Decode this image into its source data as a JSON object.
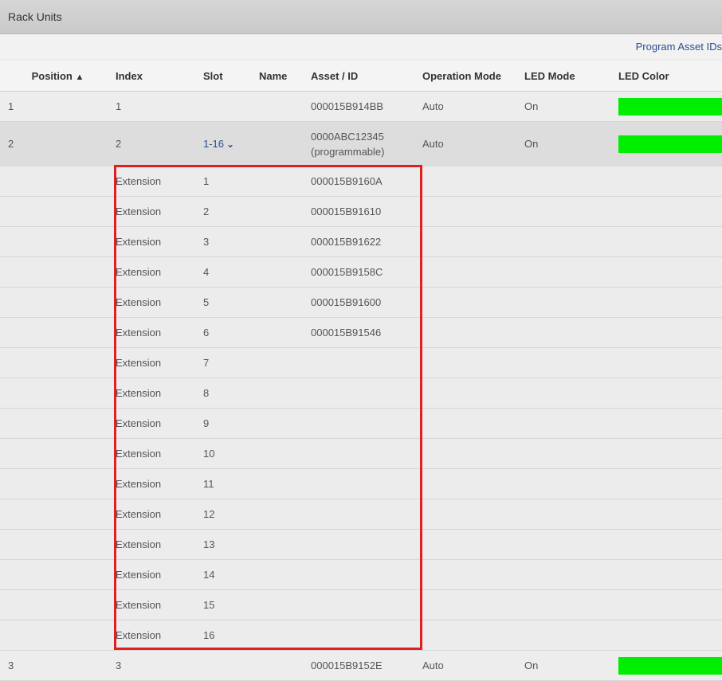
{
  "panel": {
    "title": "Rack Units",
    "program_link": "Program Asset IDs"
  },
  "columns": [
    "Position",
    "Index",
    "Slot",
    "Name",
    "Asset / ID",
    "Operation Mode",
    "LED Mode",
    "LED Color"
  ],
  "sort_indicator": "▲",
  "rows": [
    {
      "position": "1",
      "index": "1",
      "slot": "",
      "name": "",
      "asset": "000015B914BB",
      "asset_note": "",
      "mode": "Auto",
      "led_mode": "On",
      "led_color": "#00ee00"
    },
    {
      "position": "2",
      "index": "2",
      "slot": "1-16",
      "name": "",
      "asset": "0000ABC12345",
      "asset_note": "(programmable)",
      "mode": "Auto",
      "led_mode": "On",
      "led_color": "#00ee00"
    },
    {
      "position": "3",
      "index": "3",
      "slot": "",
      "name": "",
      "asset": "000015B9152E",
      "asset_note": "",
      "mode": "Auto",
      "led_mode": "On",
      "led_color": "#00ee00"
    }
  ],
  "extensions": [
    {
      "label": "Extension",
      "slot": "1",
      "asset": "000015B9160A"
    },
    {
      "label": "Extension",
      "slot": "2",
      "asset": "000015B91610"
    },
    {
      "label": "Extension",
      "slot": "3",
      "asset": "000015B91622"
    },
    {
      "label": "Extension",
      "slot": "4",
      "asset": "000015B9158C"
    },
    {
      "label": "Extension",
      "slot": "5",
      "asset": "000015B91600"
    },
    {
      "label": "Extension",
      "slot": "6",
      "asset": "000015B91546"
    },
    {
      "label": "Extension",
      "slot": "7",
      "asset": ""
    },
    {
      "label": "Extension",
      "slot": "8",
      "asset": ""
    },
    {
      "label": "Extension",
      "slot": "9",
      "asset": ""
    },
    {
      "label": "Extension",
      "slot": "10",
      "asset": ""
    },
    {
      "label": "Extension",
      "slot": "11",
      "asset": ""
    },
    {
      "label": "Extension",
      "slot": "12",
      "asset": ""
    },
    {
      "label": "Extension",
      "slot": "13",
      "asset": ""
    },
    {
      "label": "Extension",
      "slot": "14",
      "asset": ""
    },
    {
      "label": "Extension",
      "slot": "15",
      "asset": ""
    },
    {
      "label": "Extension",
      "slot": "16",
      "asset": ""
    }
  ],
  "colors": {
    "highlight_border": "#e02020",
    "link": "#2a4d8f",
    "led_on": "#00ee00"
  }
}
